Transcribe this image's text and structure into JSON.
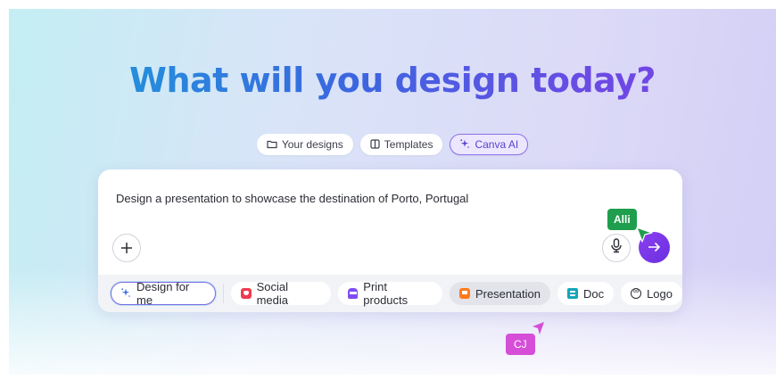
{
  "headline": "What will you design today?",
  "mode_tabs": [
    {
      "label": "Your designs",
      "icon": "folder-icon",
      "active": false
    },
    {
      "label": "Templates",
      "icon": "templates-icon",
      "active": false
    },
    {
      "label": "Canva AI",
      "icon": "sparkle-icon",
      "active": true
    }
  ],
  "prompt": {
    "text": "Design a presentation to showcase the destination of Porto, Portugal",
    "add_icon": "plus-icon",
    "mic_icon": "microphone-icon",
    "send_icon": "arrow-right-icon"
  },
  "categories": [
    {
      "label": "Design for me",
      "icon": "sparkle-icon"
    },
    {
      "label": "Social media",
      "icon": "heart-badge-icon"
    },
    {
      "label": "Print products",
      "icon": "printer-icon"
    },
    {
      "label": "Presentation",
      "icon": "presentation-icon",
      "selected": true
    },
    {
      "label": "Doc",
      "icon": "doc-icon"
    },
    {
      "label": "Logo",
      "icon": "logo-icon"
    }
  ],
  "collaborators": [
    {
      "name": "Alli",
      "color": "#1f9e4d"
    },
    {
      "name": "CJ",
      "color": "#d64ed8"
    }
  ],
  "colors": {
    "accent_purple": "#7b3fe4",
    "headline_start": "#19a2d8",
    "headline_end": "#7b3fe4"
  }
}
